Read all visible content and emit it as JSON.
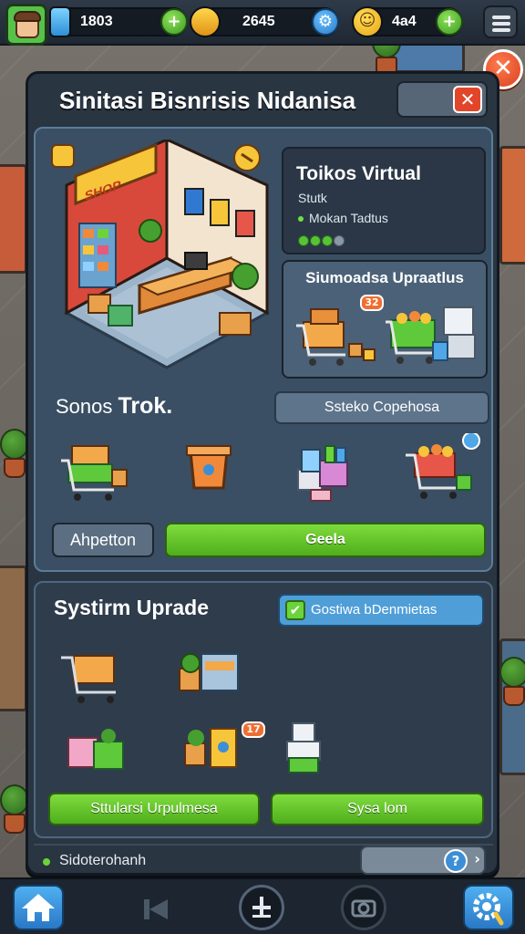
{
  "hud": {
    "resource_1": "1803",
    "resource_2": "2645",
    "resource_3": "4а4",
    "plus": "+",
    "icons": [
      "avatar-icon",
      "gem-icon",
      "lightning-icon",
      "coin-icon",
      "smile-icon",
      "menu-icon"
    ]
  },
  "panel": {
    "title": "Sinitasi Bisnrisis Nidanisa",
    "close": "✕"
  },
  "info": {
    "title": "Toikos Virtual",
    "subtitle": "Stutk",
    "line": "Mоkan Tadtus",
    "level_dots": [
      true,
      true,
      true,
      false
    ]
  },
  "upgrade": {
    "title": "Siumoadsa Upraatlus",
    "badge": "32"
  },
  "store": {
    "label_prefix": "Sonos",
    "label_main": "Trok.",
    "button": "Ssteko Copehosa"
  },
  "actions": {
    "gray": "Ahpetton",
    "green": "Geela"
  },
  "system": {
    "title": "Systirm Uprade",
    "badge": "Gostiwa bDenmietas",
    "badge_icon": "✔",
    "item_badge": "17",
    "btn_left": "Sttularsi Urpulmesa",
    "btn_right": "Sysa lom"
  },
  "status": {
    "text": "Sidoterohanh",
    "help": "?",
    "chevron": "›"
  },
  "colors": {
    "accent_green": "#5fbf26",
    "panel": "#2a3542",
    "close": "#e2462a"
  }
}
